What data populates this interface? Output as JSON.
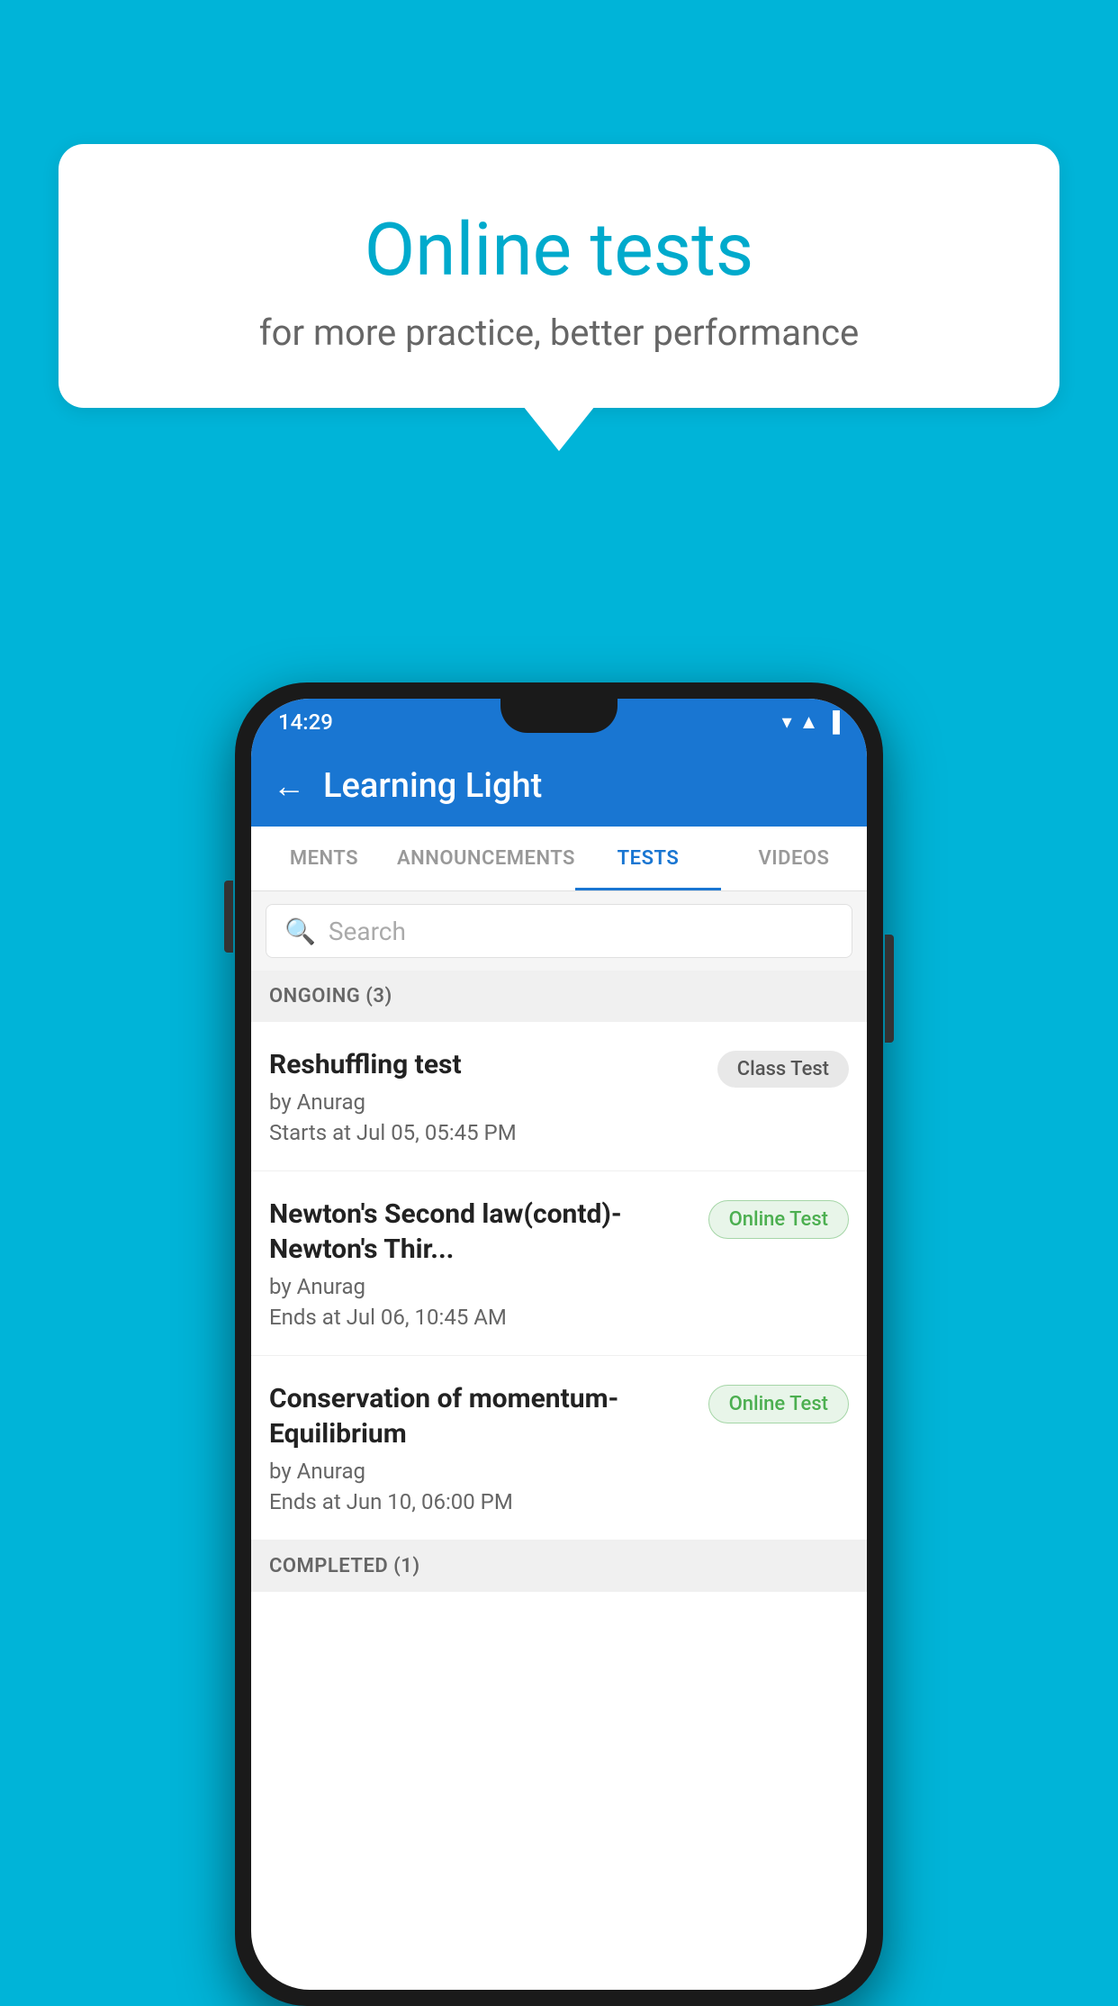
{
  "background_color": "#00B4D8",
  "speech_bubble": {
    "title": "Online tests",
    "subtitle": "for more practice, better performance"
  },
  "phone": {
    "status_bar": {
      "time": "14:29",
      "icons": [
        "wifi",
        "signal",
        "battery"
      ]
    },
    "app_bar": {
      "back_label": "←",
      "title": "Learning Light"
    },
    "tabs": [
      {
        "label": "MENTS",
        "active": false
      },
      {
        "label": "ANNOUNCEMENTS",
        "active": false
      },
      {
        "label": "TESTS",
        "active": true
      },
      {
        "label": "VIDEOS",
        "active": false
      }
    ],
    "search": {
      "placeholder": "Search"
    },
    "ongoing_section": {
      "label": "ONGOING (3)"
    },
    "tests": [
      {
        "title": "Reshuffling test",
        "author": "by Anurag",
        "date": "Starts at  Jul 05, 05:45 PM",
        "badge": "Class Test",
        "badge_type": "class"
      },
      {
        "title": "Newton's Second law(contd)-Newton's Thir...",
        "author": "by Anurag",
        "date": "Ends at  Jul 06, 10:45 AM",
        "badge": "Online Test",
        "badge_type": "online"
      },
      {
        "title": "Conservation of momentum-Equilibrium",
        "author": "by Anurag",
        "date": "Ends at  Jun 10, 06:00 PM",
        "badge": "Online Test",
        "badge_type": "online"
      }
    ],
    "completed_section": {
      "label": "COMPLETED (1)"
    }
  }
}
